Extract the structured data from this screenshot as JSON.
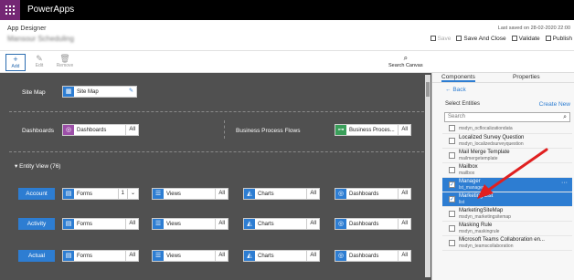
{
  "app": {
    "brand": "PowerApps",
    "designer": "App Designer",
    "app_name": "Mansour Scheduling"
  },
  "header": {
    "last_saved": "Last saved on 28-02-2020 22:00",
    "actions": {
      "save": "Save",
      "save_close": "Save And Close",
      "validate": "Validate",
      "publish": "Publish"
    }
  },
  "toolbar": {
    "add": "Add",
    "edit": "Edit",
    "remove": "Remove",
    "search_canvas": "Search Canvas"
  },
  "canvas": {
    "site_map_label": "Site Map",
    "site_map_box": "Site Map",
    "dashboards_label": "Dashboards",
    "dashboards_box": "Dashboards",
    "dashboards_all": "All",
    "bpf_label": "Business Process Flows",
    "bpf_box": "Business Proces...",
    "bpf_all": "All",
    "entity_view": "Entity View (76)",
    "rows": [
      {
        "entity": "Account",
        "forms": "Forms",
        "forms_count": "1",
        "views": "Views",
        "views_all": "All",
        "charts": "Charts",
        "charts_all": "All",
        "dash": "Dashboards",
        "dash_all": "All"
      },
      {
        "entity": "Activity",
        "forms": "Forms",
        "forms_all": "All",
        "views": "Views",
        "views_all": "All",
        "charts": "Charts",
        "charts_all": "All",
        "dash": "Dashboards",
        "dash_all": "All"
      },
      {
        "entity": "Actual",
        "forms": "Forms",
        "forms_all": "All",
        "views": "Views",
        "views_all": "All",
        "charts": "Charts",
        "charts_all": "All",
        "dash": "Dashboards",
        "dash_all": "All"
      }
    ]
  },
  "panel": {
    "tabs": [
      "Components",
      "Properties"
    ],
    "back": "Back",
    "select_entities": "Select Entities",
    "create_new": "Create New",
    "search_placeholder": "Search",
    "items": [
      {
        "name": "",
        "sub": "msdyn_ocflocalizationdata",
        "checked": false
      },
      {
        "name": "Localized Survey Question",
        "sub": "msdyn_localizedsurveyquestion",
        "checked": false
      },
      {
        "name": "Mail Merge Template",
        "sub": "mailmergetemplate",
        "checked": false
      },
      {
        "name": "Mailbox",
        "sub": "mailbox",
        "checked": false
      },
      {
        "name": "Manager",
        "sub": "lst_manager",
        "checked": true
      },
      {
        "name": "Marketing List",
        "sub": "list",
        "checked": true
      },
      {
        "name": "MarketingSiteMap",
        "sub": "msdyn_marketingsitemap",
        "checked": false
      },
      {
        "name": "Masking Rule",
        "sub": "msdyn_maskingrule",
        "checked": false
      },
      {
        "name": "Microsoft Teams Collaboration en...",
        "sub": "msdyn_teamscollaboration",
        "checked": false
      }
    ]
  },
  "colors": {
    "accent": "#2d7dd2",
    "canvas": "#505050",
    "brand": "#742774"
  }
}
